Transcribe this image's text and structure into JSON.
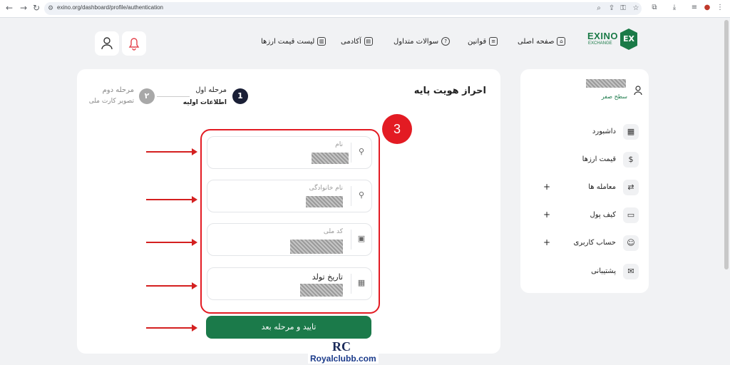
{
  "browser": {
    "url": "exino.org/dashboard/profile/authentication",
    "nav_icons": [
      "back-icon",
      "forward-icon",
      "reload-icon"
    ]
  },
  "header": {
    "logo_text": "EXINO",
    "logo_sub": "EXCHANGE",
    "logo_badge": "EX",
    "nav": [
      "صفحه اصلی",
      "قوانین",
      "سوالات متداول",
      "آکادمی",
      "لیست قیمت ارزها"
    ]
  },
  "sidebar": {
    "level": "سطح صفر",
    "items": [
      {
        "label": "داشبورد",
        "plus": ""
      },
      {
        "label": "قیمت ارزها",
        "plus": ""
      },
      {
        "label": "معامله ها",
        "plus": "+"
      },
      {
        "label": "کیف پول",
        "plus": "+"
      },
      {
        "label": "حساب کاربری",
        "plus": "+"
      },
      {
        "label": "پشتیبانی",
        "plus": ""
      }
    ]
  },
  "main": {
    "title": "احراز هویت پایه",
    "step1": {
      "num": "1",
      "title": "مرحله اول",
      "sub": "اطلاعات اولیه"
    },
    "step2": {
      "num": "۲",
      "title": "مرحله دوم",
      "sub": "تصویر کارت ملی"
    },
    "fields": [
      {
        "label": "نام"
      },
      {
        "label": "نام خانوادگی"
      },
      {
        "label": "کد ملی"
      },
      {
        "label": "تاریخ تولد"
      }
    ],
    "submit": "تایید و مرحله بعد"
  },
  "annotation": {
    "number": "3",
    "color": "#e31b23"
  },
  "watermark": {
    "logo": "RC",
    "site": "Royalclubb.com"
  },
  "colors": {
    "brand": "#1b7a4a",
    "annotation": "#e31b23"
  }
}
